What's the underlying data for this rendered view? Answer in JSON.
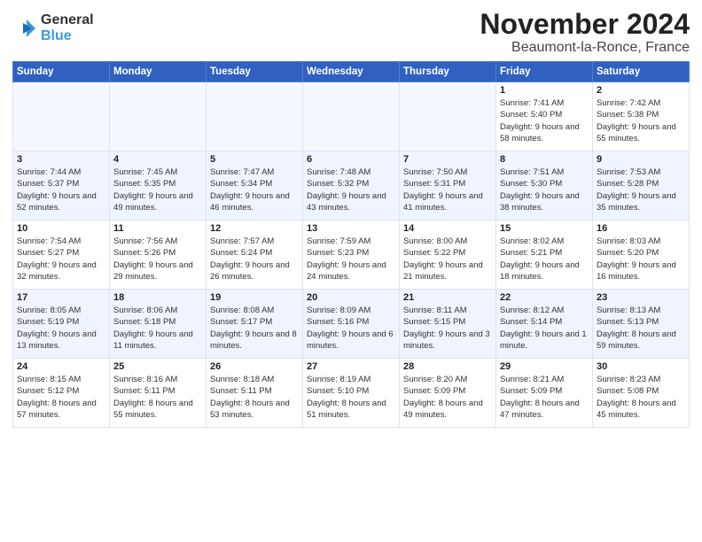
{
  "header": {
    "logo_line1": "General",
    "logo_line2": "Blue",
    "month": "November 2024",
    "location": "Beaumont-la-Ronce, France"
  },
  "weekdays": [
    "Sunday",
    "Monday",
    "Tuesday",
    "Wednesday",
    "Thursday",
    "Friday",
    "Saturday"
  ],
  "weeks": [
    [
      {
        "day": "",
        "sunrise": "",
        "sunset": "",
        "daylight": ""
      },
      {
        "day": "",
        "sunrise": "",
        "sunset": "",
        "daylight": ""
      },
      {
        "day": "",
        "sunrise": "",
        "sunset": "",
        "daylight": ""
      },
      {
        "day": "",
        "sunrise": "",
        "sunset": "",
        "daylight": ""
      },
      {
        "day": "",
        "sunrise": "",
        "sunset": "",
        "daylight": ""
      },
      {
        "day": "1",
        "sunrise": "Sunrise: 7:41 AM",
        "sunset": "Sunset: 5:40 PM",
        "daylight": "Daylight: 9 hours and 58 minutes."
      },
      {
        "day": "2",
        "sunrise": "Sunrise: 7:42 AM",
        "sunset": "Sunset: 5:38 PM",
        "daylight": "Daylight: 9 hours and 55 minutes."
      }
    ],
    [
      {
        "day": "3",
        "sunrise": "Sunrise: 7:44 AM",
        "sunset": "Sunset: 5:37 PM",
        "daylight": "Daylight: 9 hours and 52 minutes."
      },
      {
        "day": "4",
        "sunrise": "Sunrise: 7:45 AM",
        "sunset": "Sunset: 5:35 PM",
        "daylight": "Daylight: 9 hours and 49 minutes."
      },
      {
        "day": "5",
        "sunrise": "Sunrise: 7:47 AM",
        "sunset": "Sunset: 5:34 PM",
        "daylight": "Daylight: 9 hours and 46 minutes."
      },
      {
        "day": "6",
        "sunrise": "Sunrise: 7:48 AM",
        "sunset": "Sunset: 5:32 PM",
        "daylight": "Daylight: 9 hours and 43 minutes."
      },
      {
        "day": "7",
        "sunrise": "Sunrise: 7:50 AM",
        "sunset": "Sunset: 5:31 PM",
        "daylight": "Daylight: 9 hours and 41 minutes."
      },
      {
        "day": "8",
        "sunrise": "Sunrise: 7:51 AM",
        "sunset": "Sunset: 5:30 PM",
        "daylight": "Daylight: 9 hours and 38 minutes."
      },
      {
        "day": "9",
        "sunrise": "Sunrise: 7:53 AM",
        "sunset": "Sunset: 5:28 PM",
        "daylight": "Daylight: 9 hours and 35 minutes."
      }
    ],
    [
      {
        "day": "10",
        "sunrise": "Sunrise: 7:54 AM",
        "sunset": "Sunset: 5:27 PM",
        "daylight": "Daylight: 9 hours and 32 minutes."
      },
      {
        "day": "11",
        "sunrise": "Sunrise: 7:56 AM",
        "sunset": "Sunset: 5:26 PM",
        "daylight": "Daylight: 9 hours and 29 minutes."
      },
      {
        "day": "12",
        "sunrise": "Sunrise: 7:57 AM",
        "sunset": "Sunset: 5:24 PM",
        "daylight": "Daylight: 9 hours and 26 minutes."
      },
      {
        "day": "13",
        "sunrise": "Sunrise: 7:59 AM",
        "sunset": "Sunset: 5:23 PM",
        "daylight": "Daylight: 9 hours and 24 minutes."
      },
      {
        "day": "14",
        "sunrise": "Sunrise: 8:00 AM",
        "sunset": "Sunset: 5:22 PM",
        "daylight": "Daylight: 9 hours and 21 minutes."
      },
      {
        "day": "15",
        "sunrise": "Sunrise: 8:02 AM",
        "sunset": "Sunset: 5:21 PM",
        "daylight": "Daylight: 9 hours and 18 minutes."
      },
      {
        "day": "16",
        "sunrise": "Sunrise: 8:03 AM",
        "sunset": "Sunset: 5:20 PM",
        "daylight": "Daylight: 9 hours and 16 minutes."
      }
    ],
    [
      {
        "day": "17",
        "sunrise": "Sunrise: 8:05 AM",
        "sunset": "Sunset: 5:19 PM",
        "daylight": "Daylight: 9 hours and 13 minutes."
      },
      {
        "day": "18",
        "sunrise": "Sunrise: 8:06 AM",
        "sunset": "Sunset: 5:18 PM",
        "daylight": "Daylight: 9 hours and 11 minutes."
      },
      {
        "day": "19",
        "sunrise": "Sunrise: 8:08 AM",
        "sunset": "Sunset: 5:17 PM",
        "daylight": "Daylight: 9 hours and 8 minutes."
      },
      {
        "day": "20",
        "sunrise": "Sunrise: 8:09 AM",
        "sunset": "Sunset: 5:16 PM",
        "daylight": "Daylight: 9 hours and 6 minutes."
      },
      {
        "day": "21",
        "sunrise": "Sunrise: 8:11 AM",
        "sunset": "Sunset: 5:15 PM",
        "daylight": "Daylight: 9 hours and 3 minutes."
      },
      {
        "day": "22",
        "sunrise": "Sunrise: 8:12 AM",
        "sunset": "Sunset: 5:14 PM",
        "daylight": "Daylight: 9 hours and 1 minute."
      },
      {
        "day": "23",
        "sunrise": "Sunrise: 8:13 AM",
        "sunset": "Sunset: 5:13 PM",
        "daylight": "Daylight: 8 hours and 59 minutes."
      }
    ],
    [
      {
        "day": "24",
        "sunrise": "Sunrise: 8:15 AM",
        "sunset": "Sunset: 5:12 PM",
        "daylight": "Daylight: 8 hours and 57 minutes."
      },
      {
        "day": "25",
        "sunrise": "Sunrise: 8:16 AM",
        "sunset": "Sunset: 5:11 PM",
        "daylight": "Daylight: 8 hours and 55 minutes."
      },
      {
        "day": "26",
        "sunrise": "Sunrise: 8:18 AM",
        "sunset": "Sunset: 5:11 PM",
        "daylight": "Daylight: 8 hours and 53 minutes."
      },
      {
        "day": "27",
        "sunrise": "Sunrise: 8:19 AM",
        "sunset": "Sunset: 5:10 PM",
        "daylight": "Daylight: 8 hours and 51 minutes."
      },
      {
        "day": "28",
        "sunrise": "Sunrise: 8:20 AM",
        "sunset": "Sunset: 5:09 PM",
        "daylight": "Daylight: 8 hours and 49 minutes."
      },
      {
        "day": "29",
        "sunrise": "Sunrise: 8:21 AM",
        "sunset": "Sunset: 5:09 PM",
        "daylight": "Daylight: 8 hours and 47 minutes."
      },
      {
        "day": "30",
        "sunrise": "Sunrise: 8:23 AM",
        "sunset": "Sunset: 5:08 PM",
        "daylight": "Daylight: 8 hours and 45 minutes."
      }
    ]
  ]
}
